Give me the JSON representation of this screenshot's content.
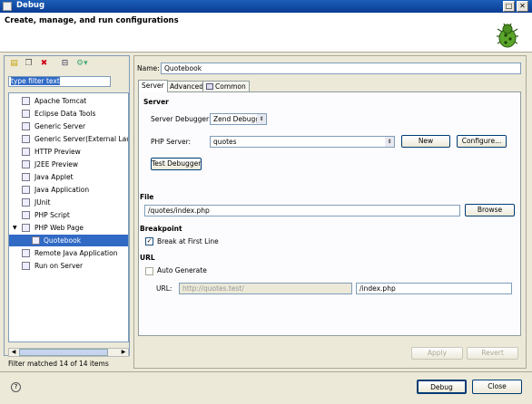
{
  "window": {
    "title": "Debug"
  },
  "banner": {
    "text": "Create, manage, and run configurations"
  },
  "left": {
    "filter_value": "type filter text",
    "items": [
      {
        "label": "Apache Tomcat",
        "icon": "tomcat-icon"
      },
      {
        "label": "Eclipse Data Tools",
        "icon": "datatools-icon"
      },
      {
        "label": "Generic Server",
        "icon": "server-icon"
      },
      {
        "label": "Generic Server(External Launc",
        "icon": "server-icon"
      },
      {
        "label": "HTTP Preview",
        "icon": "server-icon"
      },
      {
        "label": "J2EE Preview",
        "icon": "server-icon"
      },
      {
        "label": "Java Applet",
        "icon": "applet-icon"
      },
      {
        "label": "Java Application",
        "icon": "java-app-icon"
      },
      {
        "label": "JUnit",
        "icon": "junit-icon"
      },
      {
        "label": "PHP Script",
        "icon": "php-script-icon"
      },
      {
        "label": "PHP Web Page",
        "icon": "php-web-icon"
      },
      {
        "label": "Quotebook",
        "icon": "php-web-config-icon"
      },
      {
        "label": "Remote Java Application",
        "icon": "remote-java-icon"
      },
      {
        "label": "Run on Server",
        "icon": "run-server-icon"
      }
    ],
    "filter_message": "Filter matched 14 of 14 items"
  },
  "right": {
    "name_label": "Name:",
    "name_value": "Quotebook",
    "tabs": [
      "Server",
      "Advanced",
      "Common"
    ],
    "server_section": "Server",
    "server_debugger_label": "Server Debugger:",
    "server_debugger_value": "Zend Debugg",
    "php_server_label": "PHP Server:",
    "php_server_value": "quotes",
    "new_button": "New",
    "configure_button": "Configure...",
    "test_debugger_button": "Test Debugger",
    "file_section": "File",
    "file_value": "/quotes/index.php",
    "browse_button": "Browse",
    "breakpoint_section": "Breakpoint",
    "break_first_line_label": "Break at First Line",
    "url_section": "URL",
    "auto_generate_label": "Auto Generate",
    "url_label": "URL:",
    "url_base_value": "http://quotes.test/",
    "url_path_value": "/index.php",
    "apply_button": "Apply",
    "revert_button": "Revert"
  },
  "footer": {
    "debug_button": "Debug",
    "close_button": "Close"
  },
  "colors": {
    "selection": "#316ac5",
    "titlebar": "#0a3c94",
    "window_bg": "#ece9d8"
  }
}
